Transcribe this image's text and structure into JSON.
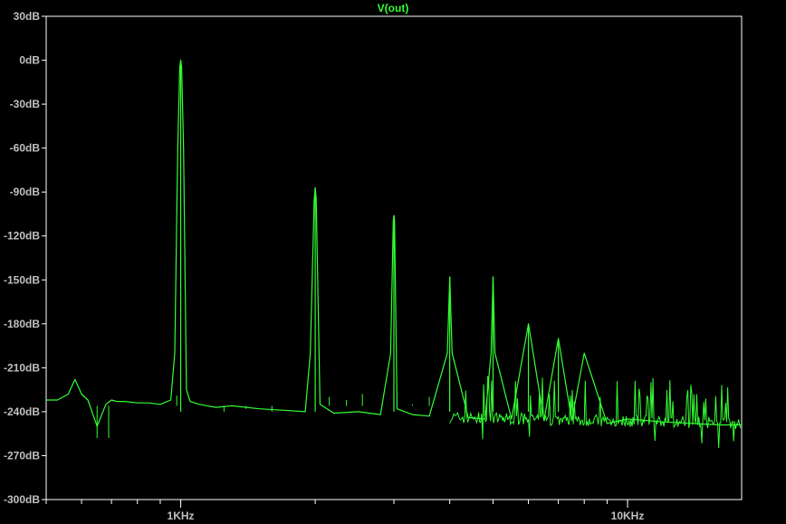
{
  "chart_data": {
    "type": "line",
    "title": "V(out)",
    "xscale": "log",
    "x_unit": "Hz",
    "xlim": [
      500,
      18000
    ],
    "ylim": [
      -300,
      30
    ],
    "y_ticks": [
      30,
      0,
      -30,
      -60,
      -90,
      -120,
      -150,
      -180,
      -210,
      -240,
      -270,
      -300
    ],
    "y_tick_labels": [
      "30dB",
      "0dB",
      "-30dB",
      "-60dB",
      "-90dB",
      "-120dB",
      "-150dB",
      "-180dB",
      "-210dB",
      "-240dB",
      "-270dB",
      "-300dB"
    ],
    "x_ticks": [
      1000,
      10000
    ],
    "x_tick_labels": [
      "1KHz",
      "10KHz"
    ],
    "grid": false,
    "colors": {
      "background": "#000000",
      "frame": "#ffffff",
      "trace": "#33ff33",
      "tick_text": "#c0c0c0"
    },
    "series": [
      {
        "name": "V(out)",
        "x": [
          500,
          530,
          560,
          580,
          600,
          620,
          650,
          680,
          700,
          720,
          750,
          800,
          850,
          900,
          950,
          970,
          985,
          995,
          1000,
          1005,
          1015,
          1030,
          1050,
          1100,
          1200,
          1300,
          1500,
          1700,
          1900,
          1950,
          1990,
          2000,
          2010,
          2050,
          2200,
          2500,
          2800,
          2950,
          2990,
          3000,
          3010,
          3050,
          3300,
          3600,
          3950,
          4000,
          4050,
          4400,
          4800,
          4950,
          5000,
          5050,
          5500,
          6000,
          6500,
          7000,
          7500,
          8000,
          9000,
          10000,
          12000,
          14000,
          16000,
          18000
        ],
        "y": [
          -232,
          -232,
          -228,
          -218,
          -228,
          -232,
          -250,
          -235,
          -232,
          -233,
          -233,
          -234,
          -234,
          -235,
          -232,
          -200,
          -60,
          -5,
          0,
          -5,
          -60,
          -225,
          -233,
          -235,
          -237,
          -236,
          -238,
          -239,
          -240,
          -200,
          -95,
          -87,
          -95,
          -235,
          -241,
          -240,
          -242,
          -200,
          -110,
          -106,
          -110,
          -238,
          -242,
          -243,
          -200,
          -148,
          -200,
          -244,
          -245,
          -200,
          -148,
          -200,
          -245,
          -180,
          -246,
          -190,
          -246,
          -200,
          -248,
          -245,
          -247,
          -248,
          -249,
          -249
        ]
      }
    ],
    "peaks": [
      {
        "x": 1000,
        "y": 0
      },
      {
        "x": 2000,
        "y": -87
      },
      {
        "x": 3000,
        "y": -106
      },
      {
        "x": 4000,
        "y": -148
      },
      {
        "x": 5000,
        "y": -148
      },
      {
        "x": 6000,
        "y": -180
      },
      {
        "x": 7000,
        "y": -190
      }
    ]
  }
}
